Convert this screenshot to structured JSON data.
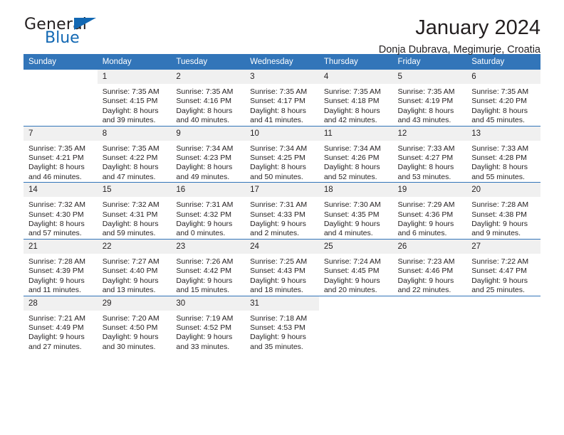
{
  "brand": {
    "name_top": "General",
    "name_bottom": "Blue",
    "accent_color": "#1268b3",
    "triangle_icon": "brand-triangle-icon"
  },
  "header": {
    "title": "January 2024",
    "subtitle": "Donja Dubrava, Megimurje, Croatia"
  },
  "calendar": {
    "header_bg": "#3275b9",
    "daynum_bg": "#f0f0f0",
    "weekday_headers": [
      "Sunday",
      "Monday",
      "Tuesday",
      "Wednesday",
      "Thursday",
      "Friday",
      "Saturday"
    ],
    "weeks": [
      [
        {
          "day": "",
          "lines": []
        },
        {
          "day": "1",
          "lines": [
            "Sunrise: 7:35 AM",
            "Sunset: 4:15 PM",
            "Daylight: 8 hours",
            "and 39 minutes."
          ]
        },
        {
          "day": "2",
          "lines": [
            "Sunrise: 7:35 AM",
            "Sunset: 4:16 PM",
            "Daylight: 8 hours",
            "and 40 minutes."
          ]
        },
        {
          "day": "3",
          "lines": [
            "Sunrise: 7:35 AM",
            "Sunset: 4:17 PM",
            "Daylight: 8 hours",
            "and 41 minutes."
          ]
        },
        {
          "day": "4",
          "lines": [
            "Sunrise: 7:35 AM",
            "Sunset: 4:18 PM",
            "Daylight: 8 hours",
            "and 42 minutes."
          ]
        },
        {
          "day": "5",
          "lines": [
            "Sunrise: 7:35 AM",
            "Sunset: 4:19 PM",
            "Daylight: 8 hours",
            "and 43 minutes."
          ]
        },
        {
          "day": "6",
          "lines": [
            "Sunrise: 7:35 AM",
            "Sunset: 4:20 PM",
            "Daylight: 8 hours",
            "and 45 minutes."
          ]
        }
      ],
      [
        {
          "day": "7",
          "lines": [
            "Sunrise: 7:35 AM",
            "Sunset: 4:21 PM",
            "Daylight: 8 hours",
            "and 46 minutes."
          ]
        },
        {
          "day": "8",
          "lines": [
            "Sunrise: 7:35 AM",
            "Sunset: 4:22 PM",
            "Daylight: 8 hours",
            "and 47 minutes."
          ]
        },
        {
          "day": "9",
          "lines": [
            "Sunrise: 7:34 AM",
            "Sunset: 4:23 PM",
            "Daylight: 8 hours",
            "and 49 minutes."
          ]
        },
        {
          "day": "10",
          "lines": [
            "Sunrise: 7:34 AM",
            "Sunset: 4:25 PM",
            "Daylight: 8 hours",
            "and 50 minutes."
          ]
        },
        {
          "day": "11",
          "lines": [
            "Sunrise: 7:34 AM",
            "Sunset: 4:26 PM",
            "Daylight: 8 hours",
            "and 52 minutes."
          ]
        },
        {
          "day": "12",
          "lines": [
            "Sunrise: 7:33 AM",
            "Sunset: 4:27 PM",
            "Daylight: 8 hours",
            "and 53 minutes."
          ]
        },
        {
          "day": "13",
          "lines": [
            "Sunrise: 7:33 AM",
            "Sunset: 4:28 PM",
            "Daylight: 8 hours",
            "and 55 minutes."
          ]
        }
      ],
      [
        {
          "day": "14",
          "lines": [
            "Sunrise: 7:32 AM",
            "Sunset: 4:30 PM",
            "Daylight: 8 hours",
            "and 57 minutes."
          ]
        },
        {
          "day": "15",
          "lines": [
            "Sunrise: 7:32 AM",
            "Sunset: 4:31 PM",
            "Daylight: 8 hours",
            "and 59 minutes."
          ]
        },
        {
          "day": "16",
          "lines": [
            "Sunrise: 7:31 AM",
            "Sunset: 4:32 PM",
            "Daylight: 9 hours",
            "and 0 minutes."
          ]
        },
        {
          "day": "17",
          "lines": [
            "Sunrise: 7:31 AM",
            "Sunset: 4:33 PM",
            "Daylight: 9 hours",
            "and 2 minutes."
          ]
        },
        {
          "day": "18",
          "lines": [
            "Sunrise: 7:30 AM",
            "Sunset: 4:35 PM",
            "Daylight: 9 hours",
            "and 4 minutes."
          ]
        },
        {
          "day": "19",
          "lines": [
            "Sunrise: 7:29 AM",
            "Sunset: 4:36 PM",
            "Daylight: 9 hours",
            "and 6 minutes."
          ]
        },
        {
          "day": "20",
          "lines": [
            "Sunrise: 7:28 AM",
            "Sunset: 4:38 PM",
            "Daylight: 9 hours",
            "and 9 minutes."
          ]
        }
      ],
      [
        {
          "day": "21",
          "lines": [
            "Sunrise: 7:28 AM",
            "Sunset: 4:39 PM",
            "Daylight: 9 hours",
            "and 11 minutes."
          ]
        },
        {
          "day": "22",
          "lines": [
            "Sunrise: 7:27 AM",
            "Sunset: 4:40 PM",
            "Daylight: 9 hours",
            "and 13 minutes."
          ]
        },
        {
          "day": "23",
          "lines": [
            "Sunrise: 7:26 AM",
            "Sunset: 4:42 PM",
            "Daylight: 9 hours",
            "and 15 minutes."
          ]
        },
        {
          "day": "24",
          "lines": [
            "Sunrise: 7:25 AM",
            "Sunset: 4:43 PM",
            "Daylight: 9 hours",
            "and 18 minutes."
          ]
        },
        {
          "day": "25",
          "lines": [
            "Sunrise: 7:24 AM",
            "Sunset: 4:45 PM",
            "Daylight: 9 hours",
            "and 20 minutes."
          ]
        },
        {
          "day": "26",
          "lines": [
            "Sunrise: 7:23 AM",
            "Sunset: 4:46 PM",
            "Daylight: 9 hours",
            "and 22 minutes."
          ]
        },
        {
          "day": "27",
          "lines": [
            "Sunrise: 7:22 AM",
            "Sunset: 4:47 PM",
            "Daylight: 9 hours",
            "and 25 minutes."
          ]
        }
      ],
      [
        {
          "day": "28",
          "lines": [
            "Sunrise: 7:21 AM",
            "Sunset: 4:49 PM",
            "Daylight: 9 hours",
            "and 27 minutes."
          ]
        },
        {
          "day": "29",
          "lines": [
            "Sunrise: 7:20 AM",
            "Sunset: 4:50 PM",
            "Daylight: 9 hours",
            "and 30 minutes."
          ]
        },
        {
          "day": "30",
          "lines": [
            "Sunrise: 7:19 AM",
            "Sunset: 4:52 PM",
            "Daylight: 9 hours",
            "and 33 minutes."
          ]
        },
        {
          "day": "31",
          "lines": [
            "Sunrise: 7:18 AM",
            "Sunset: 4:53 PM",
            "Daylight: 9 hours",
            "and 35 minutes."
          ]
        },
        {
          "day": "",
          "lines": []
        },
        {
          "day": "",
          "lines": []
        },
        {
          "day": "",
          "lines": []
        }
      ]
    ]
  }
}
